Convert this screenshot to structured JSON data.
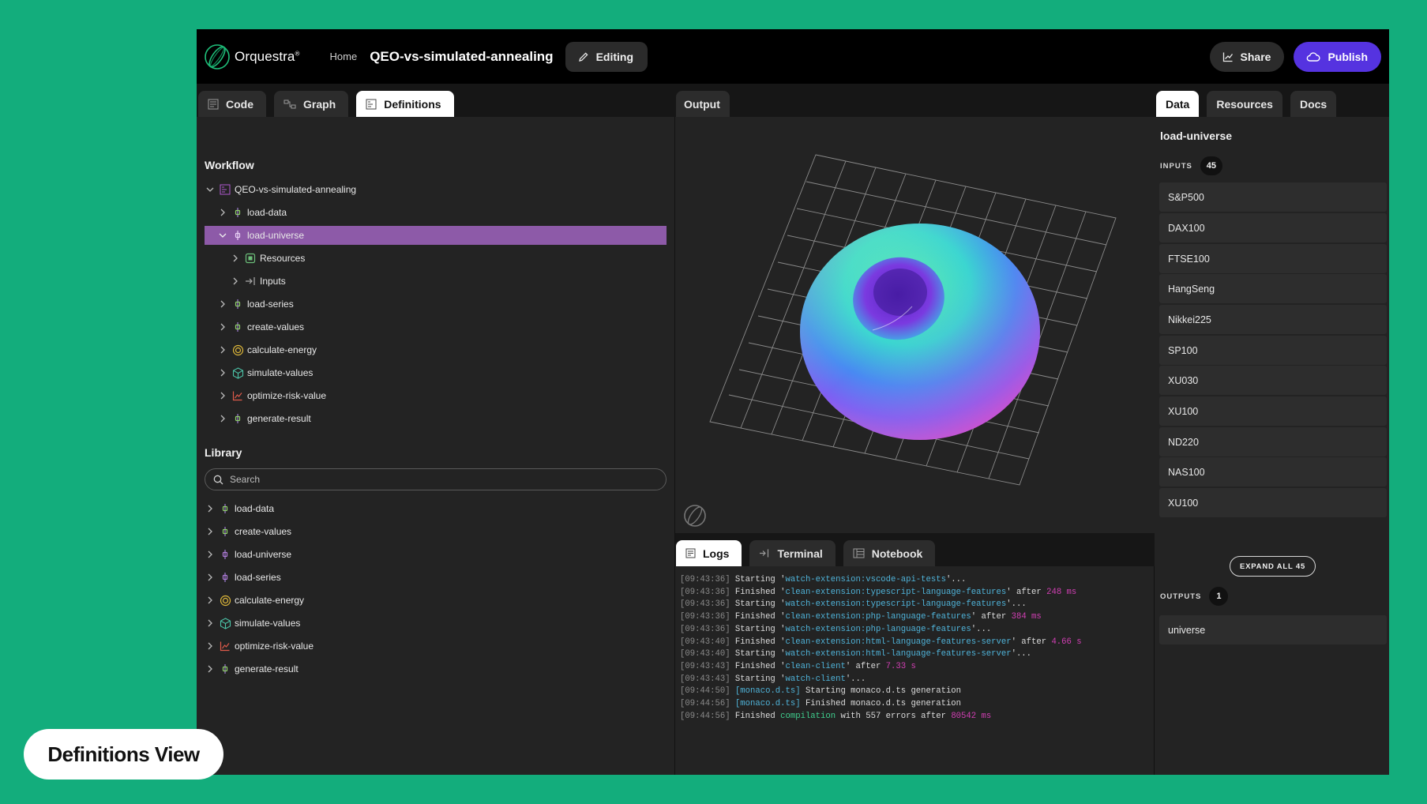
{
  "header": {
    "brand": "Orquestra",
    "brand_mark": "®",
    "home": "Home",
    "title": "QEO-vs-simulated-annealing",
    "editing": "Editing",
    "share": "Share",
    "publish": "Publish"
  },
  "left_tabs": [
    "Code",
    "Graph",
    "Definitions"
  ],
  "workflow": {
    "title": "Workflow",
    "root": "QEO-vs-simulated-annealing",
    "items": [
      {
        "label": "load-data",
        "icon": "step-icon"
      },
      {
        "label": "load-universe",
        "icon": "step-icon",
        "selected": true
      },
      {
        "label": "Resources",
        "icon": "resources-icon"
      },
      {
        "label": "Inputs",
        "icon": "inputs-icon"
      },
      {
        "label": "load-series",
        "icon": "step-icon"
      },
      {
        "label": "create-values",
        "icon": "step-icon"
      },
      {
        "label": "calculate-energy",
        "icon": "energy-icon"
      },
      {
        "label": "simulate-values",
        "icon": "cube-icon"
      },
      {
        "label": "optimize-risk-value",
        "icon": "chart-icon"
      },
      {
        "label": "generate-result",
        "icon": "step-icon"
      }
    ]
  },
  "library": {
    "title": "Library",
    "search_placeholder": "Search",
    "items": [
      {
        "label": "load-data",
        "icon": "step-icon"
      },
      {
        "label": "create-values",
        "icon": "step-icon"
      },
      {
        "label": "load-universe",
        "icon": "step-icon"
      },
      {
        "label": "load-series",
        "icon": "step-icon"
      },
      {
        "label": "calculate-energy",
        "icon": "energy-icon"
      },
      {
        "label": "simulate-values",
        "icon": "cube-icon"
      },
      {
        "label": "optimize-risk-value",
        "icon": "chart-icon"
      },
      {
        "label": "generate-result",
        "icon": "step-icon"
      }
    ]
  },
  "output_tab": "Output",
  "bottom_tabs": [
    "Logs",
    "Terminal",
    "Notebook"
  ],
  "logs": [
    {
      "ts": "[09:43:36]",
      "parts": [
        [
          "",
          " Starting '"
        ],
        [
          "cy",
          "watch-extension:vscode-api-tests"
        ],
        [
          "",
          "'..."
        ]
      ]
    },
    {
      "ts": "[09:43:36]",
      "parts": [
        [
          "",
          " Finished '"
        ],
        [
          "cy",
          "clean-extension:typescript-language-features"
        ],
        [
          "",
          "' after "
        ],
        [
          "mg",
          "248 ms"
        ]
      ]
    },
    {
      "ts": "[09:43:36]",
      "parts": [
        [
          "",
          " Starting '"
        ],
        [
          "cy",
          "watch-extension:typescript-language-features"
        ],
        [
          "",
          "'..."
        ]
      ]
    },
    {
      "ts": "[09:43:36]",
      "parts": [
        [
          "",
          " Finished '"
        ],
        [
          "cy",
          "clean-extension:php-language-features"
        ],
        [
          "",
          "' after "
        ],
        [
          "mg",
          "384 ms"
        ]
      ]
    },
    {
      "ts": "[09:43:36]",
      "parts": [
        [
          "",
          " Starting '"
        ],
        [
          "cy",
          "watch-extension:php-language-features"
        ],
        [
          "",
          "'..."
        ]
      ]
    },
    {
      "ts": "[09:43:40]",
      "parts": [
        [
          "",
          " Finished '"
        ],
        [
          "cy",
          "clean-extension:html-language-features-server"
        ],
        [
          "",
          "' after "
        ],
        [
          "mg",
          "4.66 s"
        ]
      ]
    },
    {
      "ts": "[09:43:40]",
      "parts": [
        [
          "",
          " Starting '"
        ],
        [
          "cy",
          "watch-extension:html-language-features-server"
        ],
        [
          "",
          "'..."
        ]
      ]
    },
    {
      "ts": "[09:43:43]",
      "parts": [
        [
          "",
          " Finished '"
        ],
        [
          "cy",
          "clean-client"
        ],
        [
          "",
          "' after "
        ],
        [
          "mg",
          "7.33 s"
        ]
      ]
    },
    {
      "ts": "[09:43:43]",
      "parts": [
        [
          "",
          " Starting '"
        ],
        [
          "cy",
          "watch-client"
        ],
        [
          "",
          "'..."
        ]
      ]
    },
    {
      "ts": "[09:44:50]",
      "parts": [
        [
          "",
          " "
        ],
        [
          "cy",
          "[monaco.d.ts]"
        ],
        [
          "",
          " Starting monaco.d.ts generation"
        ]
      ]
    },
    {
      "ts": "[09:44:56]",
      "parts": [
        [
          "",
          " "
        ],
        [
          "cy",
          "[monaco.d.ts]"
        ],
        [
          "",
          " Finished monaco.d.ts generation"
        ]
      ]
    },
    {
      "ts": "[09:44:56]",
      "parts": [
        [
          "",
          " Finished "
        ],
        [
          "gr",
          "compilation"
        ],
        [
          "",
          " with 557 errors after "
        ],
        [
          "mg",
          "80542 ms"
        ]
      ]
    }
  ],
  "right_tabs": [
    "Data",
    "Resources",
    "Docs"
  ],
  "data_panel": {
    "title": "load-universe",
    "inputs_label": "INPUTS",
    "inputs_count": "45",
    "inputs": [
      "S&P500",
      "DAX100",
      "FTSE100",
      "HangSeng",
      "Nikkei225",
      "SP100",
      "XU030",
      "XU100",
      "ND220",
      "NAS100",
      "XU100"
    ],
    "expand_label": "EXPAND ALL 45",
    "outputs_label": "OUTPUTS",
    "outputs_count": "1",
    "outputs": [
      "universe"
    ]
  },
  "badge": "Definitions View",
  "colors": {
    "background": "#13ad7c",
    "selected_row": "#8d5aa8",
    "publish": "#5533e0"
  }
}
